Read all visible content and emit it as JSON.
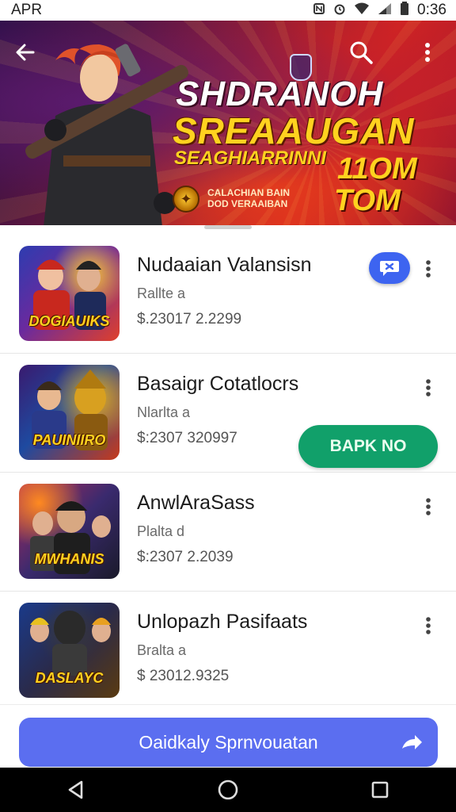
{
  "status_bar": {
    "carrier": "APR",
    "time": "0:36",
    "icons": [
      "nfc-icon",
      "alarm-icon",
      "wifi-icon",
      "signal-icon",
      "battery-icon"
    ]
  },
  "banner": {
    "title_line_1": "SHDRANOH",
    "title_line_2": "SREAAUGAN",
    "title_line_3": "SEAGHIARRINNI",
    "badge_line_1": "11OM",
    "badge_line_2": "TOM",
    "subtitle": "CALACHIAN BAIN DOD VERAAIBAN",
    "colors": {
      "accent_yellow": "#ffd21f",
      "accent_red": "#d8261e",
      "deep_purple": "#2a0f45"
    }
  },
  "toolbar": {
    "back_icon": "back-arrow-icon",
    "search_icon": "search-icon",
    "more_icon": "more-vert-icon"
  },
  "items": [
    {
      "title": "Nudaaian Valansisn",
      "sub": "Rallte a",
      "price": "$.23017 2.2299",
      "thumb_text": "DOGIAUIKS",
      "thumb_colors": [
        "#2d3cb0",
        "#e0402a",
        "#ffcc33"
      ]
    },
    {
      "title": "Basaigr Cotatlocrs",
      "sub": "Nlarlta a",
      "price": "$:2307 320997",
      "thumb_text": "PAUINIIRO",
      "thumb_colors": [
        "#3a1a6e",
        "#e5b020",
        "#c83a1a"
      ]
    },
    {
      "title": "AnwlAraSass",
      "sub": "Plalta d",
      "price": "$:2307 2.2039",
      "thumb_text": "MWHANIS",
      "thumb_colors": [
        "#b02a5a",
        "#1a1a1a",
        "#ff8a20"
      ]
    },
    {
      "title": "Unlopazh Pasifaats",
      "sub": "Bralta a",
      "price": "$ 23012.9325",
      "thumb_text": "DASLAYC",
      "thumb_colors": [
        "#1a3a8a",
        "#2a2a2a",
        "#f0b020"
      ]
    }
  ],
  "chat_badge": {
    "icon": "chat-bubble-icon",
    "glyph": "✕"
  },
  "install_button": {
    "label": "BAPK NO",
    "color": "#11a06a"
  },
  "cta": {
    "label": "Oaidkaly Sprnvouatan",
    "arrow_icon": "share-arrow-icon",
    "color": "#5b6ef0"
  },
  "nav": {
    "back": "nav-back-icon",
    "home": "nav-home-icon",
    "recents": "nav-recents-icon"
  }
}
